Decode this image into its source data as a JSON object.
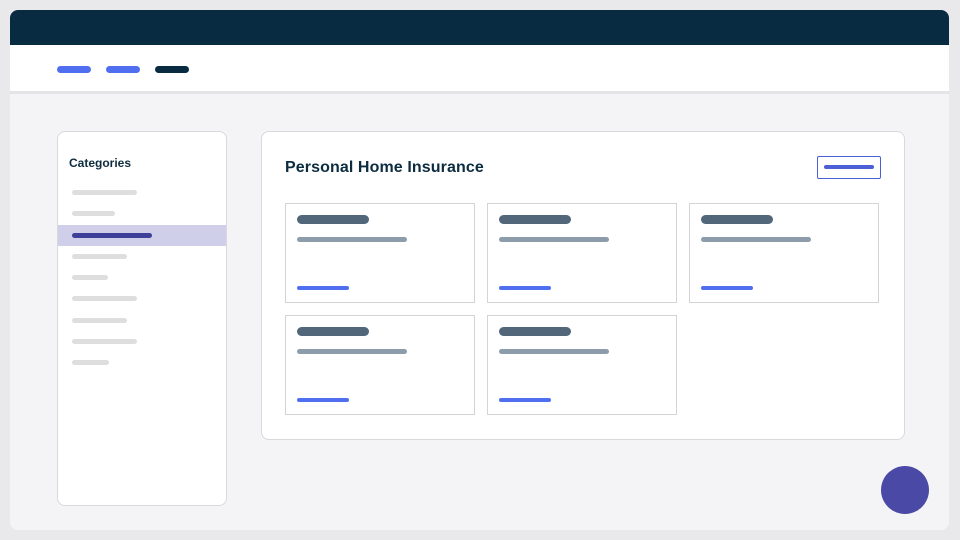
{
  "colors": {
    "topbar": "#082b42",
    "accent": "#4f6ef0",
    "nav_dark": "#0d2c40",
    "active_bg": "#cfcfe9",
    "active_bar": "#3e3f99",
    "fab": "#4a4aa6"
  },
  "nav": {
    "items": [
      {
        "icon": "placeholder-pill",
        "state": "link"
      },
      {
        "icon": "placeholder-pill",
        "state": "link"
      },
      {
        "icon": "placeholder-pill",
        "state": "current"
      }
    ]
  },
  "sidebar": {
    "title": "Categories",
    "items": [
      {
        "active": false
      },
      {
        "active": false
      },
      {
        "active": true
      },
      {
        "active": false
      },
      {
        "active": false
      },
      {
        "active": false
      },
      {
        "active": false
      },
      {
        "active": false
      },
      {
        "active": false
      }
    ]
  },
  "main": {
    "title": "Personal Home Insurance",
    "action_button": {
      "icon": "placeholder-bar"
    },
    "cards": [
      {
        "icon": "placeholder-card"
      },
      {
        "icon": "placeholder-card"
      },
      {
        "icon": "placeholder-card"
      },
      {
        "icon": "placeholder-card"
      },
      {
        "icon": "placeholder-card"
      }
    ]
  },
  "fab": {
    "icon": "chat-bubble-icon"
  }
}
